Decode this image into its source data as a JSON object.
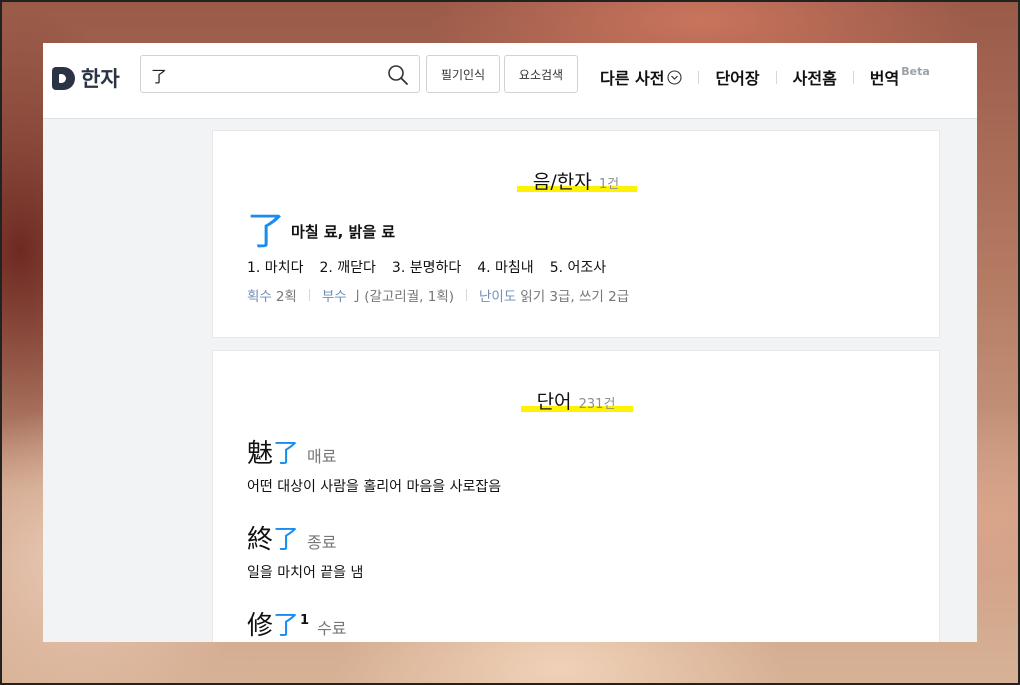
{
  "header": {
    "logo_text": "한자",
    "search_value": "了",
    "btn_handwrite": "필기인식",
    "btn_element": "요소검색",
    "nav": {
      "other_dict": "다른 사전",
      "wordbook": "단어장",
      "home": "사전홈",
      "translate": "번역",
      "beta": "Beta"
    }
  },
  "section_hanja": {
    "title": "음/한자",
    "count": "1건",
    "char": "了",
    "reading": "마칠 료, 밝을 료",
    "meanings": [
      "1. 마치다",
      "2. 깨닫다",
      "3. 분명하다",
      "4. 마침내",
      "5. 어조사"
    ],
    "meta": {
      "strokes_label": "획수",
      "strokes_value": "2획",
      "radical_label": "부수",
      "radical_value": "亅(갈고리궐, 1획)",
      "level_label": "난이도",
      "level_value": "읽기 3급, 쓰기 2급"
    }
  },
  "section_words": {
    "title": "단어",
    "count": "231건",
    "items": [
      {
        "hanja_a": "魅",
        "hanja_b": "了",
        "sup": "",
        "reading": "매료",
        "definition": "어떤 대상이 사람을 홀리어 마음을 사로잡음"
      },
      {
        "hanja_a": "終",
        "hanja_b": "了",
        "sup": "",
        "reading": "종료",
        "definition": "일을 마치어 끝을 냄"
      },
      {
        "hanja_a": "修",
        "hanja_b": "了",
        "sup": "1",
        "reading": "수료",
        "definition": ""
      }
    ]
  },
  "colors": {
    "accent": "#1a8bf0",
    "highlight": "#fff200",
    "brand": "#2b3445"
  }
}
